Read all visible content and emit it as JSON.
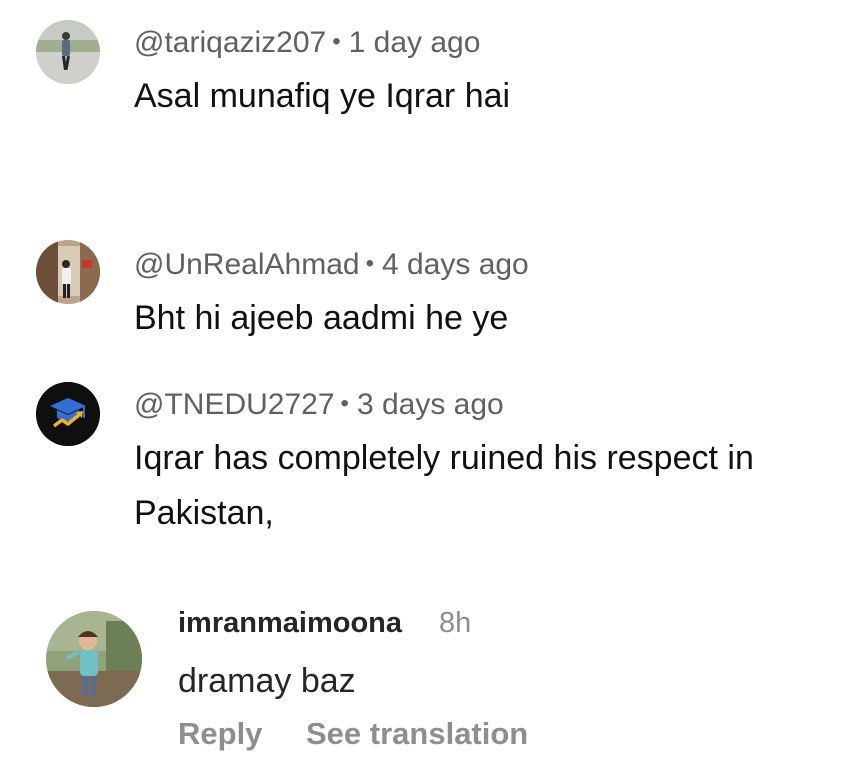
{
  "comments": [
    {
      "handle": "@tariqaziz207",
      "separator": "•",
      "time": "1 day ago",
      "text": "Asal munafiq ye Iqrar hai"
    },
    {
      "handle": "@UnRealAhmad",
      "separator": "•",
      "time": "4 days ago",
      "text": "Bht hi ajeeb aadmi he ye"
    },
    {
      "handle": "@TNEDU2727",
      "separator": "•",
      "time": "3 days ago",
      "text_line1": "Iqrar has completely ruined his  respect in",
      "text_line2": "Pakistan,"
    }
  ],
  "reply_comment": {
    "username": "imranmaimoona",
    "time": "8h",
    "text": "dramay baz",
    "reply_label": "Reply",
    "translate_label": "See translation"
  },
  "colors": {
    "meta_text": "#606060",
    "body_text": "#111111",
    "ig_secondary": "#8e8e8e",
    "ig_primary": "#262626",
    "edu_avatar_bg": "#0f0f0f",
    "edu_cap": "#2f6fd6",
    "edu_arrow": "#f2b21b"
  }
}
